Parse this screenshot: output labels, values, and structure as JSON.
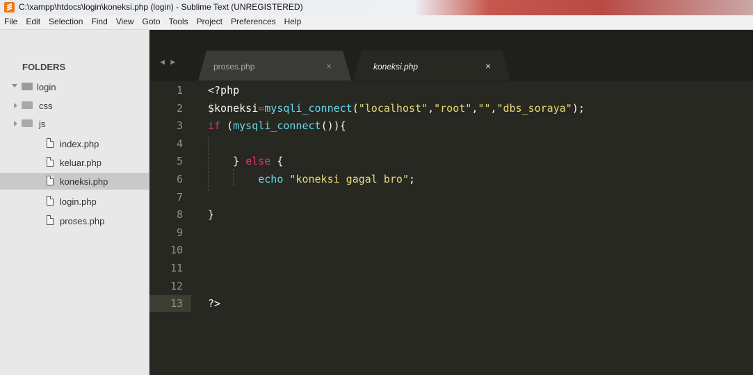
{
  "window": {
    "title": "C:\\xampp\\htdocs\\login\\koneksi.php (login) - Sublime Text (UNREGISTERED)"
  },
  "menu": [
    "File",
    "Edit",
    "Selection",
    "Find",
    "View",
    "Goto",
    "Tools",
    "Project",
    "Preferences",
    "Help"
  ],
  "sidebar": {
    "header": "FOLDERS",
    "root": "login",
    "folders": [
      "css",
      "js"
    ],
    "files": [
      "index.php",
      "keluar.php",
      "koneksi.php",
      "login.php",
      "proses.php"
    ],
    "selected_file": "koneksi.php"
  },
  "tabs": [
    {
      "label": "proses.php",
      "active": false,
      "close": "×"
    },
    {
      "label": "koneksi.php",
      "active": true,
      "close": "×"
    }
  ],
  "tab_nav": "◀ ▶",
  "editor": {
    "current_line": 13,
    "lines": [
      {
        "n": "1",
        "tokens": [
          [
            "<?php",
            "#f8f8f2"
          ]
        ]
      },
      {
        "n": "2",
        "tokens": [
          [
            "$koneksi",
            "#f8f8f2"
          ],
          [
            "=",
            "#f92672"
          ],
          [
            "mysqli_connect",
            "#66d9ef"
          ],
          [
            "(",
            "#f8f8f2"
          ],
          [
            "\"localhost\"",
            "#e6db74"
          ],
          [
            ",",
            "#f8f8f2"
          ],
          [
            "\"root\"",
            "#e6db74"
          ],
          [
            ",",
            "#f8f8f2"
          ],
          [
            "\"\"",
            "#e6db74"
          ],
          [
            ",",
            "#f8f8f2"
          ],
          [
            "\"dbs_soraya\"",
            "#e6db74"
          ],
          [
            ");",
            "#f8f8f2"
          ]
        ]
      },
      {
        "n": "3",
        "tokens": [
          [
            "if",
            "#f92672"
          ],
          [
            " (",
            "#f8f8f2"
          ],
          [
            "mysqli_connect",
            "#66d9ef"
          ],
          [
            "()){",
            "#f8f8f2"
          ]
        ]
      },
      {
        "n": "4",
        "tokens": []
      },
      {
        "n": "5",
        "tokens": [
          [
            "    } ",
            "#f8f8f2"
          ],
          [
            "else",
            "#f92672"
          ],
          [
            " {",
            "#f8f8f2"
          ]
        ]
      },
      {
        "n": "6",
        "tokens": [
          [
            "        ",
            "#f8f8f2"
          ],
          [
            "echo",
            "#66d9ef"
          ],
          [
            " ",
            "#f8f8f2"
          ],
          [
            "\"koneksi gagal bro\"",
            "#e6db74"
          ],
          [
            ";",
            "#f8f8f2"
          ]
        ]
      },
      {
        "n": "7",
        "tokens": []
      },
      {
        "n": "8",
        "tokens": [
          [
            "}",
            "#f8f8f2"
          ]
        ]
      },
      {
        "n": "9",
        "tokens": []
      },
      {
        "n": "10",
        "tokens": []
      },
      {
        "n": "11",
        "tokens": []
      },
      {
        "n": "12",
        "tokens": []
      },
      {
        "n": "13",
        "tokens": [
          [
            "?>",
            "#f8f8f2"
          ]
        ]
      }
    ]
  }
}
